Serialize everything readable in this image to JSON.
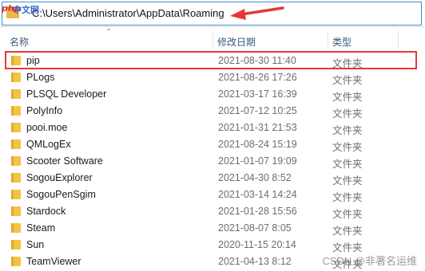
{
  "watermark": {
    "logo_php": "php",
    "logo_cn": "中文网",
    "csdn": "CSDN @非著名运维"
  },
  "address": {
    "path": "C:\\Users\\Administrator\\AppData\\Roaming"
  },
  "columns": {
    "name": "名称",
    "modified": "修改日期",
    "type": "类型"
  },
  "colors": {
    "highlight": "#e53935",
    "folder": "#f3c343",
    "arrow": "#e53935"
  },
  "files": [
    {
      "name": "pip",
      "modified": "2021-08-30 11:40",
      "type": "文件夹",
      "highlighted": true
    },
    {
      "name": "PLogs",
      "modified": "2021-08-26 17:26",
      "type": "文件夹"
    },
    {
      "name": "PLSQL Developer",
      "modified": "2021-03-17 16:39",
      "type": "文件夹"
    },
    {
      "name": "PolyInfo",
      "modified": "2021-07-12 10:25",
      "type": "文件夹"
    },
    {
      "name": "pooi.moe",
      "modified": "2021-01-31 21:53",
      "type": "文件夹"
    },
    {
      "name": "QMLogEx",
      "modified": "2021-08-24 15:19",
      "type": "文件夹"
    },
    {
      "name": "Scooter Software",
      "modified": "2021-01-07 19:09",
      "type": "文件夹"
    },
    {
      "name": "SogouExplorer",
      "modified": "2021-04-30 8:52",
      "type": "文件夹"
    },
    {
      "name": "SogouPenSgim",
      "modified": "2021-03-14 14:24",
      "type": "文件夹"
    },
    {
      "name": "Stardock",
      "modified": "2021-01-28 15:56",
      "type": "文件夹"
    },
    {
      "name": "Steam",
      "modified": "2021-08-07 8:05",
      "type": "文件夹"
    },
    {
      "name": "Sun",
      "modified": "2020-11-15 20:14",
      "type": "文件夹"
    },
    {
      "name": "TeamViewer",
      "modified": "2021-04-13 8:12",
      "type": "文件夹"
    }
  ]
}
